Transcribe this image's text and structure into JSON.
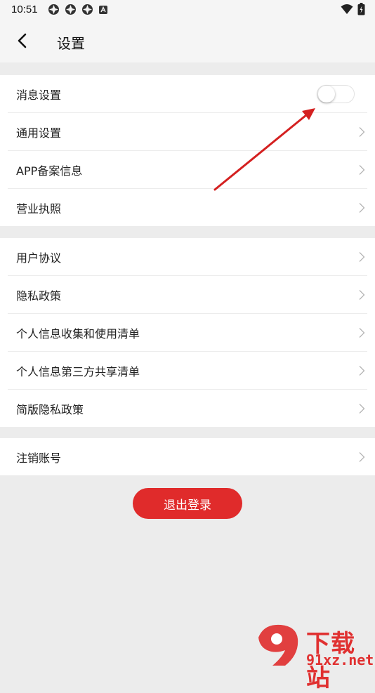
{
  "status_bar": {
    "time": "10:51"
  },
  "header": {
    "title": "设置"
  },
  "groups": [
    {
      "items": [
        {
          "label": "消息设置",
          "control": "toggle",
          "toggle_on": false
        },
        {
          "label": "通用设置",
          "control": "chevron"
        },
        {
          "label": "APP备案信息",
          "control": "chevron"
        },
        {
          "label": "营业执照",
          "control": "chevron"
        }
      ]
    },
    {
      "items": [
        {
          "label": "用户协议",
          "control": "chevron"
        },
        {
          "label": "隐私政策",
          "control": "chevron"
        },
        {
          "label": "个人信息收集和使用清单",
          "control": "chevron"
        },
        {
          "label": "个人信息第三方共享清单",
          "control": "chevron"
        },
        {
          "label": "简版隐私政策",
          "control": "chevron"
        }
      ]
    },
    {
      "items": [
        {
          "label": "注销账号",
          "control": "chevron"
        }
      ]
    }
  ],
  "logout_button": {
    "label": "退出登录"
  },
  "watermark": {
    "line1": "下载站",
    "line2": "91xz.net"
  },
  "colors": {
    "accent": "#e02b2b",
    "background": "#ececec",
    "card": "#ffffff"
  }
}
